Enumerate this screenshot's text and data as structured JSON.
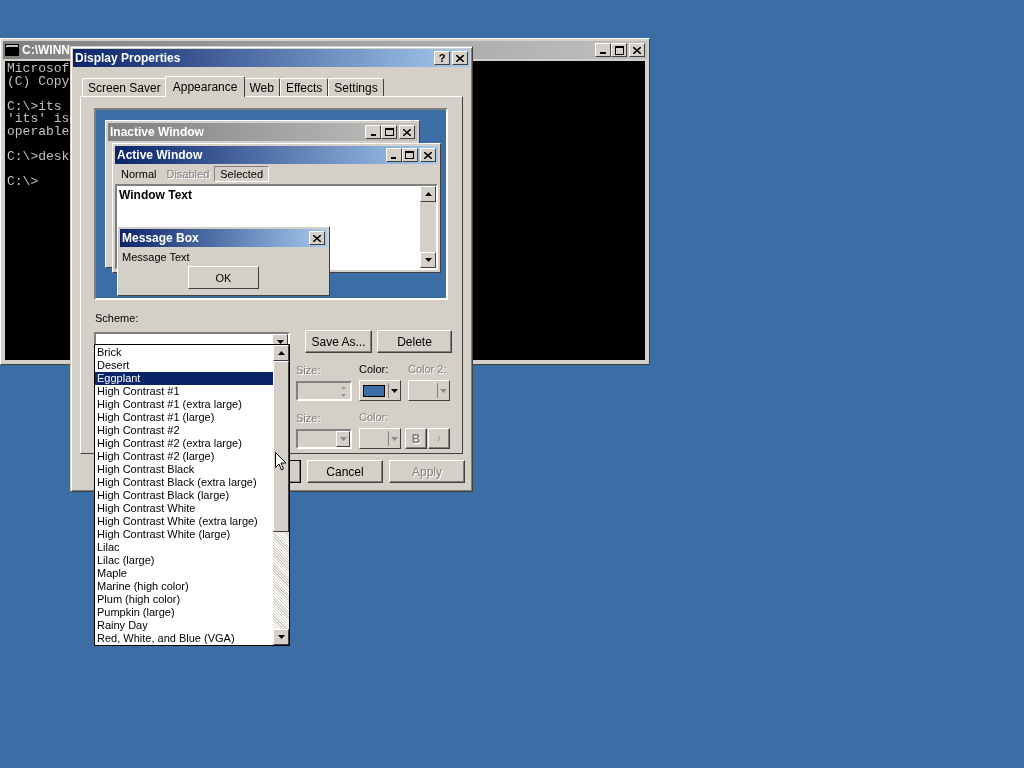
{
  "console": {
    "title": "C:\\WINN",
    "blocks": [
      [
        "Microsof",
        "(C) Copy"
      ],
      [
        "C:\\>its",
        "'its' is",
        "operable"
      ],
      [
        "C:\\>desk"
      ],
      [
        "C:\\>"
      ]
    ]
  },
  "dialog": {
    "title": "Display Properties",
    "help": "?",
    "tabs": [
      {
        "label": "Screen Saver",
        "selected": false
      },
      {
        "label": "Appearance",
        "selected": true
      },
      {
        "label": "Web",
        "selected": false
      },
      {
        "label": "Effects",
        "selected": false
      },
      {
        "label": "Settings",
        "selected": false
      }
    ],
    "preview": {
      "inactive_title": "Inactive Window",
      "active_title": "Active Window",
      "menu": [
        {
          "label": "Normal",
          "kind": "normal"
        },
        {
          "label": "Disabled",
          "kind": "disabled"
        },
        {
          "label": "Selected",
          "kind": "selected"
        }
      ],
      "window_text": "Window Text",
      "message_title": "Message Box",
      "message_text": "Message Text",
      "ok": "OK"
    },
    "scheme": {
      "label": "Scheme:",
      "buttons": [
        "Save As...",
        "Delete"
      ],
      "items": [
        {
          "label": "Brick",
          "selected": false
        },
        {
          "label": "Desert",
          "selected": false
        },
        {
          "label": "Eggplant",
          "selected": true
        },
        {
          "label": "High Contrast #1",
          "selected": false
        },
        {
          "label": "High Contrast #1 (extra large)",
          "selected": false
        },
        {
          "label": "High Contrast #1 (large)",
          "selected": false
        },
        {
          "label": "High Contrast #2",
          "selected": false
        },
        {
          "label": "High Contrast #2 (extra large)",
          "selected": false
        },
        {
          "label": "High Contrast #2 (large)",
          "selected": false
        },
        {
          "label": "High Contrast Black",
          "selected": false
        },
        {
          "label": "High Contrast Black (extra large)",
          "selected": false
        },
        {
          "label": "High Contrast Black (large)",
          "selected": false
        },
        {
          "label": "High Contrast White",
          "selected": false
        },
        {
          "label": "High Contrast White (extra large)",
          "selected": false
        },
        {
          "label": "High Contrast White (large)",
          "selected": false
        },
        {
          "label": "Lilac",
          "selected": false
        },
        {
          "label": "Lilac (large)",
          "selected": false
        },
        {
          "label": "Maple",
          "selected": false
        },
        {
          "label": "Marine (high color)",
          "selected": false
        },
        {
          "label": "Plum (high color)",
          "selected": false
        },
        {
          "label": "Pumpkin (large)",
          "selected": false
        },
        {
          "label": "Rainy Day",
          "selected": false
        },
        {
          "label": "Red, White, and Blue (VGA)",
          "selected": false
        }
      ]
    },
    "item_row": [
      {
        "label": "Size:",
        "disabled": true
      },
      {
        "label": "Color:",
        "disabled": false,
        "color": "#3a6ea5"
      },
      {
        "label": "Color 2:",
        "disabled": true
      }
    ],
    "font_row": [
      {
        "label": "Size:",
        "disabled": true
      },
      {
        "label": "Color:",
        "disabled": true
      }
    ],
    "bold": "B",
    "footer": [
      {
        "label": "Cancel",
        "disabled": false
      },
      {
        "label": "Apply",
        "disabled": true
      }
    ]
  }
}
